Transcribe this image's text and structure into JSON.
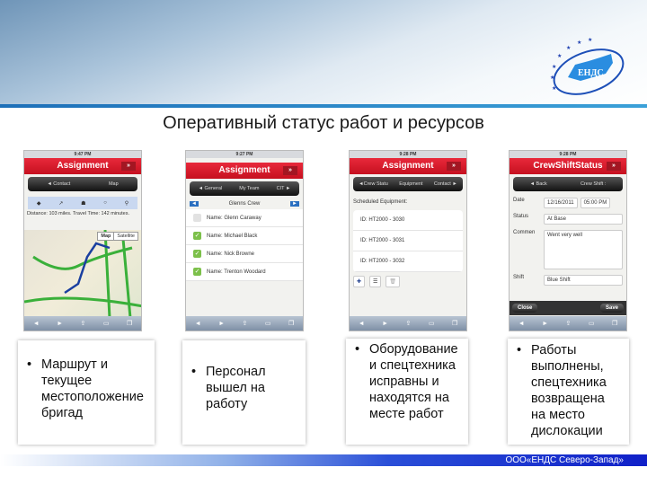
{
  "slide": {
    "title": "Оперативный статус работ и ресурсов",
    "logo_text": "ЕНДС",
    "footer": "ООО«ЕНДС Северо-Запад»"
  },
  "phones": [
    {
      "time": "9:47 PM",
      "title": "Assignment",
      "nav": [
        "◄ Contact",
        "Map"
      ],
      "distance": "Distance: 103 miles. Travel Time: 142 minutes.",
      "map_btn": "Map",
      "satellite_btn": "Satellite"
    },
    {
      "time": "9:27 PM",
      "title": "Assignment",
      "nav": [
        "◄ General",
        "My Team",
        "CIT ►"
      ],
      "crew": "Glenns Crew",
      "members": [
        {
          "name": "Name: Glenn Caraway",
          "checked": false
        },
        {
          "name": "Name: Michael Black",
          "checked": true
        },
        {
          "name": "Name: Nick Browne",
          "checked": true
        },
        {
          "name": "Name: Trenton Woodard",
          "checked": true
        }
      ]
    },
    {
      "time": "9:28 PM",
      "title": "Assignment",
      "nav": [
        "◄Crew Statu",
        "Equipment",
        "Contact ►"
      ],
      "label": "Scheduled Equipment:",
      "items": [
        "ID: HT2000 - 3030",
        "ID: HT2000 - 3031",
        "ID: HT2000 - 3032"
      ]
    },
    {
      "time": "9:28 PM",
      "title": "CrewShiftStatus",
      "nav": [
        "◄ Back",
        "Crew Shift :"
      ],
      "date_label": "Date",
      "date": "12/16/2011",
      "time_value": "05:00 PM",
      "status_label": "Status",
      "status": "At Base",
      "comment_label": "Commen",
      "comment": "Went very well",
      "shift_label": "Shift",
      "shift": "Blue Shift",
      "close": "Close",
      "save": "Save"
    }
  ],
  "captions": [
    "Маршрут и текущее местоположение бригад",
    "Персонал вышел на работу",
    "Оборудование и спецтехника исправны и находятся на месте работ",
    "Работы выполнены, спецтехника возвращена на место дислокации"
  ]
}
